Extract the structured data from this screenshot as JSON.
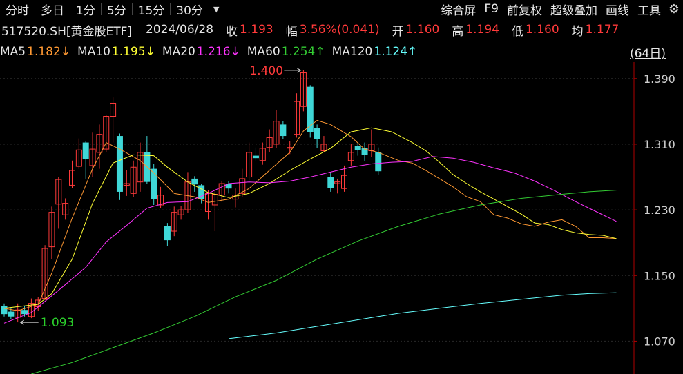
{
  "toolbar": {
    "left": [
      "分时",
      "多日",
      "1分",
      "5分",
      "15分",
      "30分"
    ],
    "more_icon": "caret-down-icon",
    "right": [
      "综合屏",
      "F9",
      "前复权",
      "超级叠加",
      "画线",
      "工具"
    ],
    "settings_icon": "gear-icon"
  },
  "quote": {
    "code": "517520.SH[黄金股ETF]",
    "date": "2024/06/28",
    "close_label": "收",
    "close": "1.193",
    "change_label": "幅",
    "change": "3.56%(0.041)",
    "open_label": "开",
    "open": "1.160",
    "high_label": "高",
    "high": "1.194",
    "low_label": "低",
    "low": "1.160",
    "avg_label": "均",
    "avg": "1.177"
  },
  "ma_bar": [
    {
      "label": "MA5",
      "value": "1.182↓",
      "color": "#ff9933"
    },
    {
      "label": "MA10",
      "value": "1.195↓",
      "color": "#ffff33"
    },
    {
      "label": "MA20",
      "value": "1.216↓",
      "color": "#ff33ff"
    },
    {
      "label": "MA60",
      "value": "1.254↑",
      "color": "#33cc33"
    },
    {
      "label": "MA120",
      "value": "1.124↑",
      "color": "#66ffff"
    }
  ],
  "range_label": "(64日)",
  "chart_data": {
    "type": "candlestick",
    "ylim": [
      1.03,
      1.41
    ],
    "yticks": [
      "1.390",
      "1.310",
      "1.230",
      "1.150",
      "1.070"
    ],
    "annotations": {
      "high": "1.400",
      "low": "1.093"
    },
    "candles": [
      [
        1.113,
        1.103,
        1.116,
        1.1
      ],
      [
        1.106,
        1.1,
        1.11,
        1.097
      ],
      [
        1.099,
        1.108,
        1.116,
        1.093
      ],
      [
        1.108,
        1.103,
        1.113,
        1.1
      ],
      [
        1.1,
        1.116,
        1.122,
        1.098
      ],
      [
        1.112,
        1.12,
        1.124,
        1.107
      ],
      [
        1.122,
        1.183,
        1.187,
        1.12
      ],
      [
        1.185,
        1.227,
        1.234,
        1.17
      ],
      [
        1.237,
        1.267,
        1.27,
        1.207
      ],
      [
        1.224,
        1.238,
        1.244,
        1.218
      ],
      [
        1.26,
        1.278,
        1.29,
        1.257
      ],
      [
        1.283,
        1.303,
        1.317,
        1.28
      ],
      [
        1.312,
        1.292,
        1.314,
        1.268
      ],
      [
        1.284,
        1.304,
        1.324,
        1.27
      ],
      [
        1.3,
        1.322,
        1.334,
        1.28
      ],
      [
        1.304,
        1.344,
        1.346,
        1.3
      ],
      [
        1.344,
        1.36,
        1.367,
        1.312
      ],
      [
        1.32,
        1.252,
        1.323,
        1.242
      ],
      [
        1.26,
        1.262,
        1.278,
        1.247
      ],
      [
        1.25,
        1.282,
        1.29,
        1.246
      ],
      [
        1.264,
        1.3,
        1.312,
        1.252
      ],
      [
        1.3,
        1.264,
        1.32,
        1.262
      ],
      [
        1.28,
        1.243,
        1.286,
        1.236
      ],
      [
        1.236,
        1.248,
        1.258,
        1.232
      ],
      [
        1.21,
        1.193,
        1.214,
        1.186
      ],
      [
        1.204,
        1.227,
        1.234,
        1.198
      ],
      [
        1.224,
        1.23,
        1.235,
        1.218
      ],
      [
        1.23,
        1.264,
        1.276,
        1.226
      ],
      [
        1.268,
        1.261,
        1.271,
        1.252
      ],
      [
        1.26,
        1.243,
        1.262,
        1.238
      ],
      [
        1.228,
        1.25,
        1.254,
        1.218
      ],
      [
        1.236,
        1.249,
        1.254,
        1.204
      ],
      [
        1.248,
        1.262,
        1.265,
        1.24
      ],
      [
        1.262,
        1.256,
        1.265,
        1.25
      ],
      [
        1.243,
        1.248,
        1.256,
        1.233
      ],
      [
        1.25,
        1.268,
        1.28,
        1.246
      ],
      [
        1.27,
        1.3,
        1.312,
        1.266
      ],
      [
        1.296,
        1.293,
        1.306,
        1.29
      ],
      [
        1.29,
        1.305,
        1.312,
        1.285
      ],
      [
        1.306,
        1.318,
        1.328,
        1.3
      ],
      [
        1.31,
        1.338,
        1.352,
        1.305
      ],
      [
        1.334,
        1.32,
        1.338,
        1.316
      ],
      [
        1.306,
        1.306,
        1.314,
        1.298
      ],
      [
        1.322,
        1.362,
        1.372,
        1.318
      ],
      [
        1.356,
        1.397,
        1.4,
        1.35
      ],
      [
        1.38,
        1.325,
        1.382,
        1.318
      ],
      [
        1.33,
        1.316,
        1.334,
        1.305
      ],
      [
        1.302,
        1.31,
        1.32,
        1.3
      ],
      [
        1.27,
        1.257,
        1.275,
        1.252
      ],
      [
        1.262,
        1.264,
        1.268,
        1.25
      ],
      [
        1.256,
        1.272,
        1.284,
        1.252
      ],
      [
        1.29,
        1.3,
        1.31,
        1.284
      ],
      [
        1.308,
        1.303,
        1.312,
        1.296
      ],
      [
        1.305,
        1.297,
        1.312,
        1.289
      ],
      [
        1.302,
        1.31,
        1.328,
        1.294
      ],
      [
        1.3,
        1.277,
        1.306,
        1.273
      ]
    ],
    "series": [
      {
        "name": "MA5",
        "color": "#ff9933",
        "points": [
          [
            0,
            1.11
          ],
          [
            2,
            1.107
          ],
          [
            5,
            1.115
          ],
          [
            7,
            1.153
          ],
          [
            10,
            1.22
          ],
          [
            13,
            1.28
          ],
          [
            15,
            1.312
          ],
          [
            17,
            1.304
          ],
          [
            20,
            1.29
          ],
          [
            22,
            1.275
          ],
          [
            25,
            1.25
          ],
          [
            28,
            1.246
          ],
          [
            30,
            1.239
          ],
          [
            33,
            1.243
          ],
          [
            36,
            1.256
          ],
          [
            39,
            1.278
          ],
          [
            42,
            1.3
          ],
          [
            44,
            1.326
          ],
          [
            46,
            1.339
          ],
          [
            48,
            1.334
          ],
          [
            51,
            1.319
          ],
          [
            53,
            1.304
          ],
          [
            55,
            1.3
          ],
          [
            58,
            1.29
          ],
          [
            60,
            1.287
          ],
          [
            62,
            1.278
          ],
          [
            64,
            1.268
          ],
          [
            66,
            1.258
          ],
          [
            68,
            1.246
          ],
          [
            70,
            1.24
          ],
          [
            72,
            1.224
          ],
          [
            74,
            1.22
          ],
          [
            76,
            1.213
          ],
          [
            78,
            1.21
          ],
          [
            80,
            1.215
          ],
          [
            82,
            1.218
          ],
          [
            84,
            1.21
          ],
          [
            86,
            1.196
          ],
          [
            88,
            1.196
          ],
          [
            90,
            1.195
          ]
        ]
      },
      {
        "name": "MA10",
        "color": "#ffff33",
        "points": [
          [
            0,
            1.11
          ],
          [
            5,
            1.115
          ],
          [
            7,
            1.128
          ],
          [
            10,
            1.17
          ],
          [
            13,
            1.238
          ],
          [
            16,
            1.287
          ],
          [
            19,
            1.297
          ],
          [
            22,
            1.296
          ],
          [
            24,
            1.282
          ],
          [
            27,
            1.264
          ],
          [
            30,
            1.251
          ],
          [
            33,
            1.245
          ],
          [
            36,
            1.25
          ],
          [
            39,
            1.262
          ],
          [
            42,
            1.278
          ],
          [
            45,
            1.292
          ],
          [
            48,
            1.305
          ],
          [
            51,
            1.325
          ],
          [
            54,
            1.33
          ],
          [
            57,
            1.325
          ],
          [
            60,
            1.312
          ],
          [
            62,
            1.302
          ],
          [
            64,
            1.288
          ],
          [
            66,
            1.273
          ],
          [
            68,
            1.262
          ],
          [
            70,
            1.252
          ],
          [
            72,
            1.243
          ],
          [
            74,
            1.234
          ],
          [
            76,
            1.225
          ],
          [
            78,
            1.214
          ],
          [
            80,
            1.212
          ],
          [
            82,
            1.206
          ],
          [
            84,
            1.202
          ],
          [
            86,
            1.2
          ],
          [
            88,
            1.199
          ],
          [
            90,
            1.195
          ]
        ]
      },
      {
        "name": "MA20",
        "color": "#ff33ff",
        "points": [
          [
            0,
            1.092
          ],
          [
            4,
            1.105
          ],
          [
            8,
            1.132
          ],
          [
            12,
            1.16
          ],
          [
            15,
            1.191
          ],
          [
            18,
            1.211
          ],
          [
            21,
            1.232
          ],
          [
            24,
            1.239
          ],
          [
            27,
            1.24
          ],
          [
            30,
            1.25
          ],
          [
            33,
            1.262
          ],
          [
            36,
            1.264
          ],
          [
            39,
            1.263
          ],
          [
            42,
            1.265
          ],
          [
            45,
            1.27
          ],
          [
            48,
            1.276
          ],
          [
            51,
            1.282
          ],
          [
            54,
            1.286
          ],
          [
            57,
            1.288
          ],
          [
            60,
            1.289
          ],
          [
            63,
            1.295
          ],
          [
            66,
            1.293
          ],
          [
            69,
            1.288
          ],
          [
            72,
            1.281
          ],
          [
            75,
            1.275
          ],
          [
            78,
            1.265
          ],
          [
            81,
            1.253
          ],
          [
            84,
            1.24
          ],
          [
            87,
            1.228
          ],
          [
            90,
            1.216
          ]
        ]
      },
      {
        "name": "MA60",
        "color": "#33cc33",
        "points": [
          [
            4,
            1.03
          ],
          [
            10,
            1.044
          ],
          [
            16,
            1.062
          ],
          [
            22,
            1.08
          ],
          [
            28,
            1.1
          ],
          [
            34,
            1.124
          ],
          [
            40,
            1.144
          ],
          [
            46,
            1.17
          ],
          [
            52,
            1.192
          ],
          [
            58,
            1.21
          ],
          [
            64,
            1.225
          ],
          [
            70,
            1.236
          ],
          [
            76,
            1.244
          ],
          [
            82,
            1.249
          ],
          [
            86,
            1.252
          ],
          [
            90,
            1.254
          ]
        ]
      },
      {
        "name": "MA120",
        "color": "#66ffff",
        "points": [
          [
            33,
            1.073
          ],
          [
            40,
            1.08
          ],
          [
            46,
            1.088
          ],
          [
            52,
            1.096
          ],
          [
            58,
            1.104
          ],
          [
            64,
            1.11
          ],
          [
            70,
            1.116
          ],
          [
            76,
            1.121
          ],
          [
            82,
            1.126
          ],
          [
            86,
            1.128
          ],
          [
            90,
            1.129
          ]
        ]
      }
    ]
  }
}
